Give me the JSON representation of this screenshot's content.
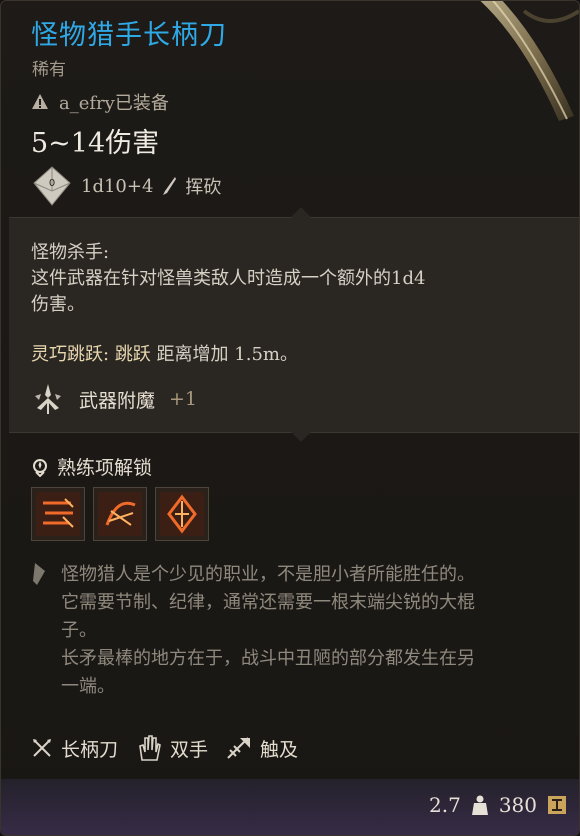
{
  "item": {
    "name": "怪物猎手长柄刀",
    "rarity": "稀有",
    "equipped_by": "a_efry已装备",
    "damage": "5~14伤害",
    "dice_value": "0",
    "damage_dice": "1d10+4",
    "damage_type": "挥砍"
  },
  "abilities": {
    "monster_slayer": {
      "label": "怪物杀手:",
      "desc_line1": "这件武器在针对怪兽类敌人时造成一个额外的1d4",
      "desc_line2": "伤害。"
    },
    "nimble_jump": {
      "label": "灵巧跳跃:",
      "keyword": "跳跃",
      "desc": "距离增加 1.5m。"
    },
    "enchantment": {
      "label": "武器附魔",
      "value": "+1"
    }
  },
  "proficiency": {
    "title": "熟练项解锁",
    "actions": [
      "cleave-action-icon",
      "sweep-action-icon",
      "pommel-action-icon"
    ]
  },
  "flavor": {
    "line1": "怪物猎人是个少见的职业，不是胆小者所能胜任的。",
    "line2": "它需要节制、纪律，通常还需要一根末端尖锐的大棍",
    "line3": "子。",
    "line4": "长矛最棒的地方在于，战斗中丑陋的部分都发生在另",
    "line5": "一端。"
  },
  "properties": [
    {
      "label": "长柄刀",
      "icon": "glaive-icon"
    },
    {
      "label": "双手",
      "icon": "two-handed-icon"
    },
    {
      "label": "触及",
      "icon": "reach-icon"
    }
  ],
  "footer": {
    "weight": "2.7",
    "price": "380"
  },
  "colors": {
    "title": "#2fa8e6",
    "gold_label": "#e9d7b0",
    "footer_top": "#24212b",
    "footer_bottom": "#372c47"
  }
}
